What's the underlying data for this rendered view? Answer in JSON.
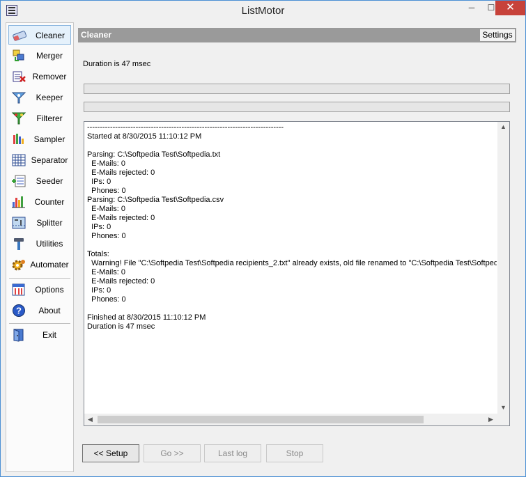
{
  "window": {
    "title": "ListMotor",
    "minimize": "─",
    "maximize": "☐",
    "close": "✕"
  },
  "sidebar": {
    "items": [
      {
        "label": "Cleaner",
        "icon": "eraser-icon"
      },
      {
        "label": "Merger",
        "icon": "merge-icon"
      },
      {
        "label": "Remover",
        "icon": "remove-icon"
      },
      {
        "label": "Keeper",
        "icon": "keeper-icon"
      },
      {
        "label": "Filterer",
        "icon": "filter-icon"
      },
      {
        "label": "Sampler",
        "icon": "sampler-icon"
      },
      {
        "label": "Separator",
        "icon": "grid-icon"
      },
      {
        "label": "Seeder",
        "icon": "seeder-icon"
      },
      {
        "label": "Counter",
        "icon": "bar-chart-icon"
      },
      {
        "label": "Splitter",
        "icon": "splitter-icon"
      },
      {
        "label": "Utilities",
        "icon": "hammer-icon"
      },
      {
        "label": "Automater",
        "icon": "gear-icon"
      },
      {
        "label": "Options",
        "icon": "options-icon"
      },
      {
        "label": "About",
        "icon": "help-icon"
      },
      {
        "label": "Exit",
        "icon": "exit-door-icon"
      }
    ]
  },
  "panel": {
    "title": "Cleaner",
    "settings_label": "Settings"
  },
  "status": {
    "duration": "Duration is 47 msec"
  },
  "log": {
    "lines": [
      "-----------------------------------------------------------------------------",
      "Started at 8/30/2015 11:10:12 PM",
      "",
      "Parsing: C:\\Softpedia Test\\Softpedia.txt",
      "  E-Mails: 0",
      "  E-Mails rejected: 0",
      "  IPs: 0",
      "  Phones: 0",
      "Parsing: C:\\Softpedia Test\\Softpedia.csv",
      "  E-Mails: 0",
      "  E-Mails rejected: 0",
      "  IPs: 0",
      "  Phones: 0",
      "",
      "Totals:",
      "  Warning! File \"C:\\Softpedia Test\\Softpedia recipients_2.txt\" already exists, old file renamed to \"C:\\Softpedia Test\\Softpedia",
      "  E-Mails: 0",
      "  E-Mails rejected: 0",
      "  IPs: 0",
      "  Phones: 0",
      "",
      "Finished at 8/30/2015 11:10:12 PM",
      "Duration is 47 msec"
    ]
  },
  "buttons": {
    "setup": "<< Setup",
    "go": "Go >>",
    "last_log": "Last log",
    "stop": "Stop"
  },
  "colors": {
    "accent": "#86b3dd",
    "header": "#9a9a9a",
    "close": "#c7423a"
  }
}
